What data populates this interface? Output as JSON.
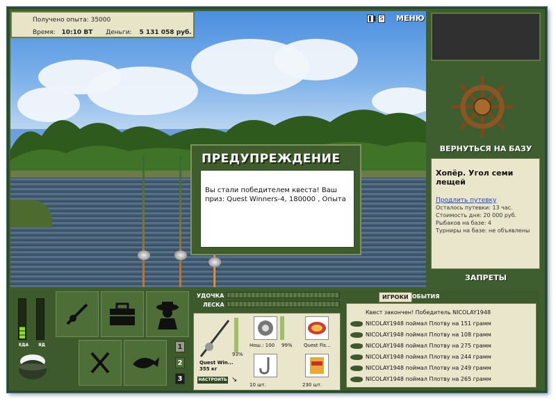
{
  "hud": {
    "xp_label": "Получено опыта: 35000",
    "time_label": "Время:",
    "time_value": "10:10 ВТ",
    "money_label": "Деньги:",
    "money_value": "5 131 058 руб."
  },
  "top": {
    "pause_icon": "pause-icon",
    "save_icon": "save-icon",
    "menu_label": "МЕНЮ"
  },
  "dialog": {
    "title": "ПРЕДУПРЕЖДЕНИЕ",
    "message": "Вы стали победителем квеста! Ваш приз: Quest Winners-4, 180000 , Опыта"
  },
  "right": {
    "return_label": "ВЕРНУТЬСЯ НА БАЗУ",
    "location": "Хопёр. Угол семи лещей",
    "extend_link": "Продлить путевку",
    "trip_left": "Осталось путевки: 13 час.",
    "day_cost": "Стоимость дня: 20 000 руб.",
    "anglers": "Рыбаков на базе: 4",
    "tournaments": "Турниры на базе: не объявлены",
    "bans_label": "ЗАПРЕТЫ"
  },
  "meters": {
    "food_label": "ЕДА",
    "poison_label": "ЯД",
    "food_level": 0.3,
    "poison_level": 0.0
  },
  "pages": [
    "1",
    "2",
    "3"
  ],
  "tackle": {
    "rod_label": "УДОЧКА",
    "line_label": "ЛЕСКА",
    "rod_name": "Quest Win...",
    "rod_weight": "355 кг",
    "rod_percent": "93%",
    "configure_label": "НАСТРОИТЬ",
    "reel_text": "Нош.: 100",
    "reel_percent": "99%",
    "bait_name": "Quest Fis...",
    "hooks_count": "10 шт.",
    "groundbait_count": "230 шт."
  },
  "events": {
    "tab_players": "ИГРОКИ",
    "tab_events": "СОБЫТИЯ",
    "quest_line": "Квест закончен! Победитель NICOLAY1948",
    "rows": [
      "NICOLAY1948 поймал Плотву на 151 грамм",
      "NICOLAY1948 поймал Плотву на 108 грамм",
      "NICOLAY1948 поймал Плотву на 275 грамм",
      "NICOLAY1948 поймал Плотву на 244 грамм",
      "NICOLAY1948 поймал Плотву на 249 грамм",
      "NICOLAY1948 поймал Плотву на 265 грамм"
    ]
  },
  "colors": {
    "frame": "#3f5e2f",
    "panel": "#e9e6cb",
    "accent_link": "#1a3fcf"
  }
}
